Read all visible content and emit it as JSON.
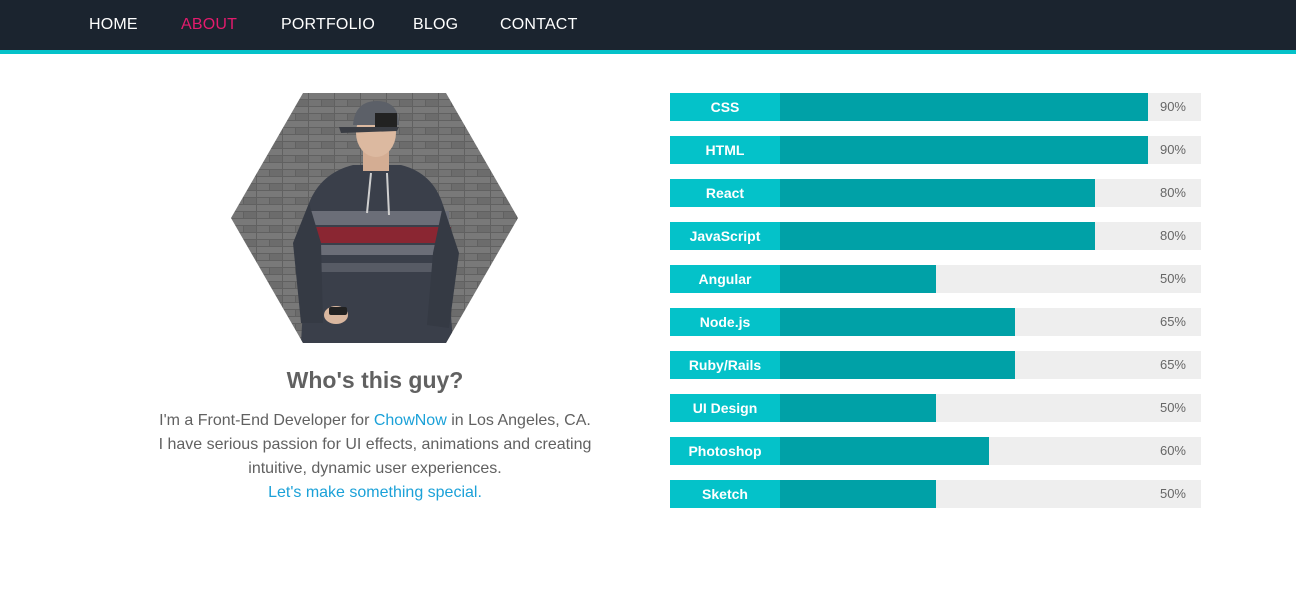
{
  "nav": {
    "items": [
      {
        "label": "HOME",
        "active": false
      },
      {
        "label": "ABOUT",
        "active": true
      },
      {
        "label": "PORTFOLIO",
        "active": false
      },
      {
        "label": "BLOG",
        "active": false
      },
      {
        "label": "CONTACT",
        "active": false
      }
    ]
  },
  "about": {
    "title": "Who's this guy?",
    "bio_line1_pre": "I'm a Front-End Developer for ",
    "company": "ChowNow",
    "bio_line1_post": " in Los Angeles, CA.",
    "bio_line2": "I have serious passion for UI effects, animations and creating",
    "bio_line3": "intuitive, dynamic user experiences.",
    "cta": "Let's make something special."
  },
  "skills": [
    {
      "name": "CSS",
      "percent": 90,
      "label": "90%"
    },
    {
      "name": "HTML",
      "percent": 90,
      "label": "90%"
    },
    {
      "name": "React",
      "percent": 80,
      "label": "80%"
    },
    {
      "name": "JavaScript",
      "percent": 80,
      "label": "80%"
    },
    {
      "name": "Angular",
      "percent": 50,
      "label": "50%"
    },
    {
      "name": "Node.js",
      "percent": 65,
      "label": "65%"
    },
    {
      "name": "Ruby/Rails",
      "percent": 65,
      "label": "65%"
    },
    {
      "name": "UI Design",
      "percent": 50,
      "label": "50%"
    },
    {
      "name": "Photoshop",
      "percent": 60,
      "label": "60%"
    },
    {
      "name": "Sketch",
      "percent": 50,
      "label": "50%"
    }
  ],
  "colors": {
    "nav_bg": "#1b242f",
    "accent": "#04c2c9",
    "bar_fill": "#00a1a7",
    "active": "#e31b6d",
    "link": "#1ba1d8"
  }
}
